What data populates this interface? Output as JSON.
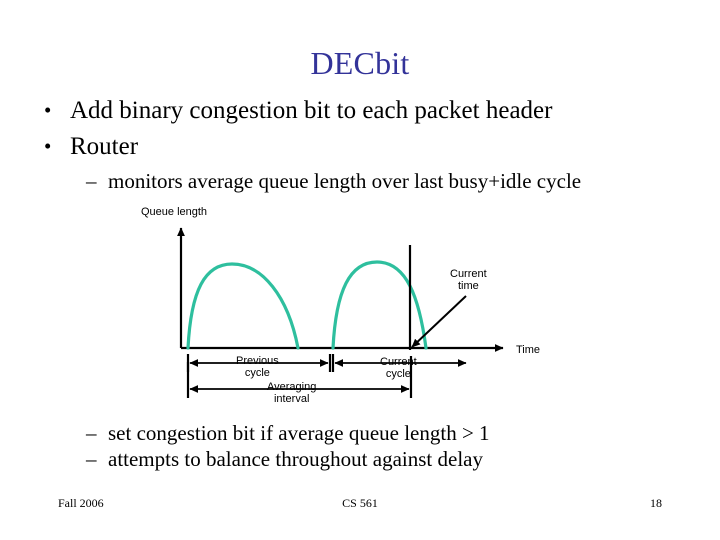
{
  "slide": {
    "title": "DECbit",
    "title_color": "#333399",
    "page_number": "18"
  },
  "bullets": [
    {
      "marker": "•",
      "text": "Add binary congestion bit to each packet header"
    },
    {
      "marker": "•",
      "text": "Router"
    }
  ],
  "sub_bullets": [
    {
      "marker": "–",
      "text": "monitors average queue length over last busy+idle cycle"
    },
    {
      "marker": "–",
      "text": "set congestion bit if average queue length > 1"
    },
    {
      "marker": "–",
      "text": "attempts to balance throughout against delay"
    }
  ],
  "diagram": {
    "y_axis_label": "Queue length",
    "x_axis_label": "Time",
    "current_time_label": "Current\ntime",
    "current_time_label_line1": "Current",
    "current_time_label_line2": "time",
    "previous_cycle_label_line1": "Previous",
    "previous_cycle_label_line2": "cycle",
    "current_cycle_label_line1": "Current",
    "current_cycle_label_line2": "cycle",
    "averaging_interval_label_line1": "Averaging",
    "averaging_interval_label_line2": "interval",
    "curve_color": "#2ebf9e",
    "axis_color": "#000000"
  },
  "chart_data": {
    "type": "line",
    "title": "",
    "xlabel": "Time",
    "ylabel": "Queue length",
    "grid": false,
    "legend": null,
    "annotations": [
      "Current time",
      "Previous cycle",
      "Current cycle",
      "Averaging interval"
    ],
    "series": [
      {
        "name": "Queue length (previous cycle)",
        "description": "busy period arch rising from zero and returning to zero",
        "x": [
          188,
          200,
          215,
          232,
          250,
          268,
          283,
          292,
          298
        ],
        "y": [
          0,
          38,
          62,
          76,
          80,
          72,
          52,
          28,
          0
        ]
      },
      {
        "name": "Queue length (current cycle)",
        "description": "busy period arch rising from zero, crossing the current-time line and returning to zero",
        "x": [
          333,
          345,
          358,
          372,
          388,
          402,
          412,
          420,
          426
        ],
        "y": [
          0,
          40,
          64,
          78,
          82,
          70,
          52,
          28,
          0
        ]
      }
    ],
    "markers": [
      {
        "name": "current-time-line",
        "x": 410,
        "type": "vertical-line"
      }
    ],
    "intervals": [
      {
        "name": "Previous cycle",
        "x_start": 188,
        "x_end": 330
      },
      {
        "name": "Current cycle",
        "x_start": 333,
        "x_end": 468
      },
      {
        "name": "Averaging interval",
        "x_start": 188,
        "x_end": 411
      }
    ],
    "ylim": [
      0,
      100
    ],
    "xlim": [
      170,
      500
    ]
  },
  "footer": {
    "left": "Fall 2006",
    "center": "CS 561",
    "right": "18"
  }
}
